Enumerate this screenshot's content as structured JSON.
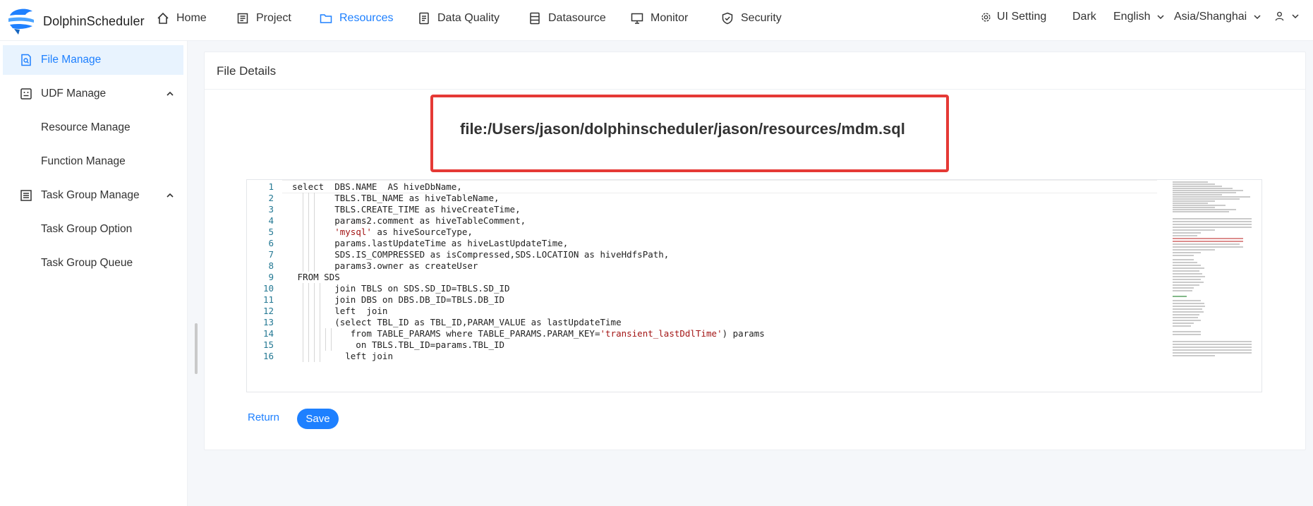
{
  "header": {
    "app_name": "DolphinScheduler",
    "nav": [
      {
        "label": "Home",
        "icon": "home-icon"
      },
      {
        "label": "Project",
        "icon": "project-icon"
      },
      {
        "label": "Resources",
        "icon": "folder-icon",
        "active": true
      },
      {
        "label": "Data Quality",
        "icon": "data-quality-icon"
      },
      {
        "label": "Datasource",
        "icon": "datasource-icon"
      },
      {
        "label": "Monitor",
        "icon": "monitor-icon"
      },
      {
        "label": "Security",
        "icon": "shield-icon"
      }
    ],
    "ui_setting": "UI Setting",
    "theme": "Dark",
    "language": "English",
    "timezone": "Asia/Shanghai"
  },
  "sidebar": {
    "items": [
      {
        "label": "File Manage",
        "active": true
      },
      {
        "label": "UDF Manage"
      },
      {
        "label": "Resource Manage"
      },
      {
        "label": "Function Manage"
      },
      {
        "label": "Task Group Manage"
      },
      {
        "label": "Task Group Option"
      },
      {
        "label": "Task Group Queue"
      }
    ]
  },
  "card": {
    "title": "File Details",
    "file_path": "file:/Users/jason/dolphinscheduler/jason/resources/mdm.sql"
  },
  "editor": {
    "line_numbers": [
      "1",
      "2",
      "3",
      "4",
      "5",
      "6",
      "7",
      "8",
      "9",
      "10",
      "11",
      "12",
      "13",
      "14",
      "15",
      "16"
    ],
    "lines": [
      "select  DBS.NAME  AS hiveDbName,",
      "        TBLS.TBL_NAME as hiveTableName,",
      "        TBLS.CREATE_TIME as hiveCreateTime,",
      "        params2.comment as hiveTableComment,",
      "        'mysql' as hiveSourceType,",
      "        params.lastUpdateTime as hiveLastUpdateTime,",
      "        SDS.IS_COMPRESSED as isCompressed,SDS.LOCATION as hiveHdfsPath,",
      "        params3.owner as createUser",
      " FROM SDS",
      "        join TBLS on SDS.SD_ID=TBLS.SD_ID",
      "        join DBS on DBS.DB_ID=TBLS.DB_ID",
      "        left  join",
      "        (select TBL_ID as TBL_ID,PARAM_VALUE as lastUpdateTime",
      "           from TABLE_PARAMS where TABLE_PARAMS.PARAM_KEY='transient_lastDdlTime') params",
      "            on TBLS.TBL_ID=params.TBL_ID",
      "          left join"
    ]
  },
  "actions": {
    "return_label": "Return",
    "save_label": "Save"
  },
  "colors": {
    "accent": "#1e80ff",
    "highlight_box": "#e53935",
    "string": "#a31515",
    "line_number": "#237893"
  }
}
